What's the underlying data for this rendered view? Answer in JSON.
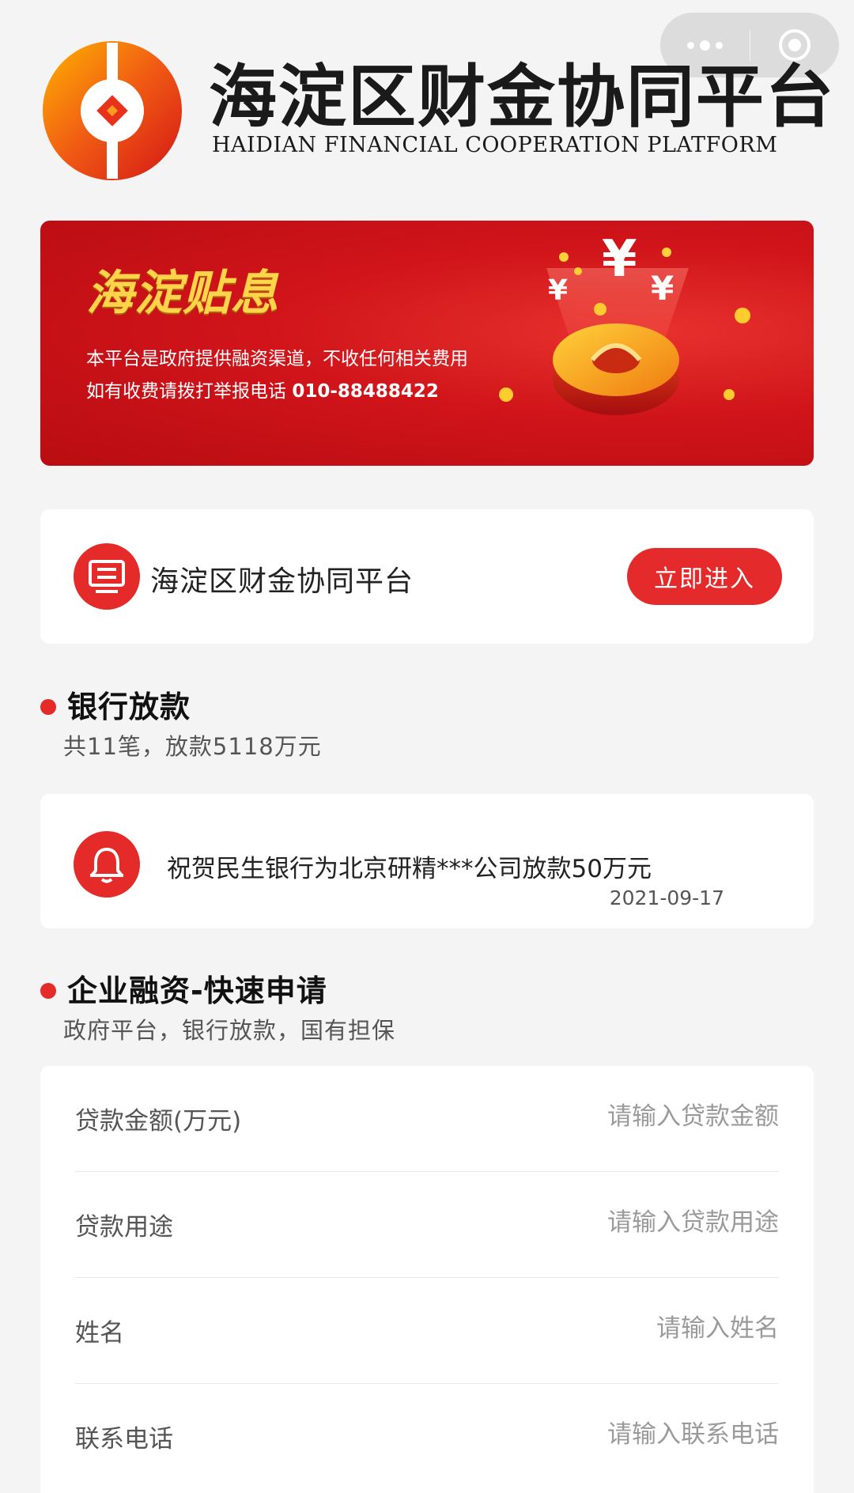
{
  "header": {
    "title": "海淀区财金协同平台",
    "subtitle": "HAIDIAN FINANCIAL COOPERATION PLATFORM"
  },
  "banner": {
    "title": "海淀贴息",
    "line1": "本平台是政府提供融资渠道，不收任何相关费用",
    "line2_prefix": "如有收费请拨打举报电话 ",
    "phone": "010-88488422"
  },
  "platform_card": {
    "name": "海淀区财金协同平台",
    "button_label": "立即进入"
  },
  "loans_section": {
    "title": "银行放款",
    "summary": "共11笔，放款5118万元"
  },
  "notice": {
    "text": "祝贺民生银行为北京研精***公司放款50万元",
    "date": "2021-09-17"
  },
  "finance_section": {
    "title": "企业融资-快速申请",
    "summary": "政府平台，银行放款，国有担保"
  },
  "form": {
    "fields": [
      {
        "label": "贷款金额(万元)",
        "placeholder": "请输入贷款金额",
        "value": ""
      },
      {
        "label": "贷款用途",
        "placeholder": "请输入贷款用途",
        "value": ""
      },
      {
        "label": "姓名",
        "placeholder": "请输入姓名",
        "value": ""
      },
      {
        "label": "联系电话",
        "placeholder": "请输入联系电话",
        "value": ""
      }
    ]
  },
  "colors": {
    "accent": "#e52a2a",
    "banner_gold": "#ffd34a",
    "page_bg": "#f4f4f4"
  },
  "icons": {
    "capsule_more": "more-dots-icon",
    "capsule_close": "target-close-icon",
    "platform": "document-list-icon",
    "notice": "bell-icon",
    "logo": "haidian-coin-logo"
  }
}
